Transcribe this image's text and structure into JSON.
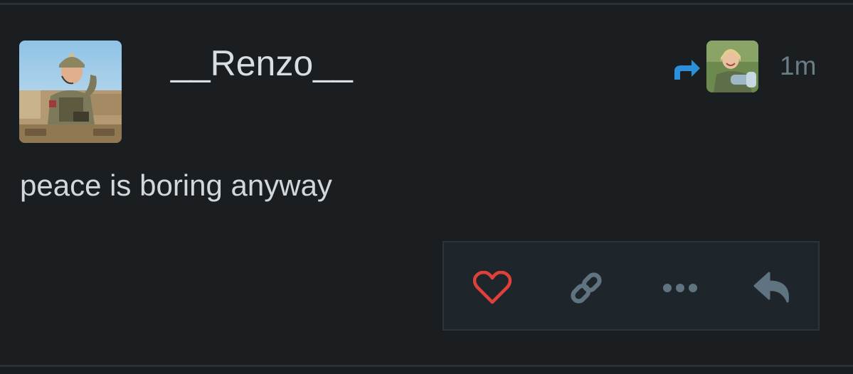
{
  "post": {
    "author": "__Renzo__",
    "time": "1m",
    "content": "peace is boring anyway"
  },
  "icons": {
    "boost": "boost-arrow-icon",
    "favourite": "heart-icon",
    "link": "link-icon",
    "more": "more-dots-icon",
    "reply": "reply-icon"
  },
  "colors": {
    "background": "#1a1e21",
    "boost": "#2b90d9",
    "heart": "#e0403a",
    "icon": "#5f7480"
  }
}
